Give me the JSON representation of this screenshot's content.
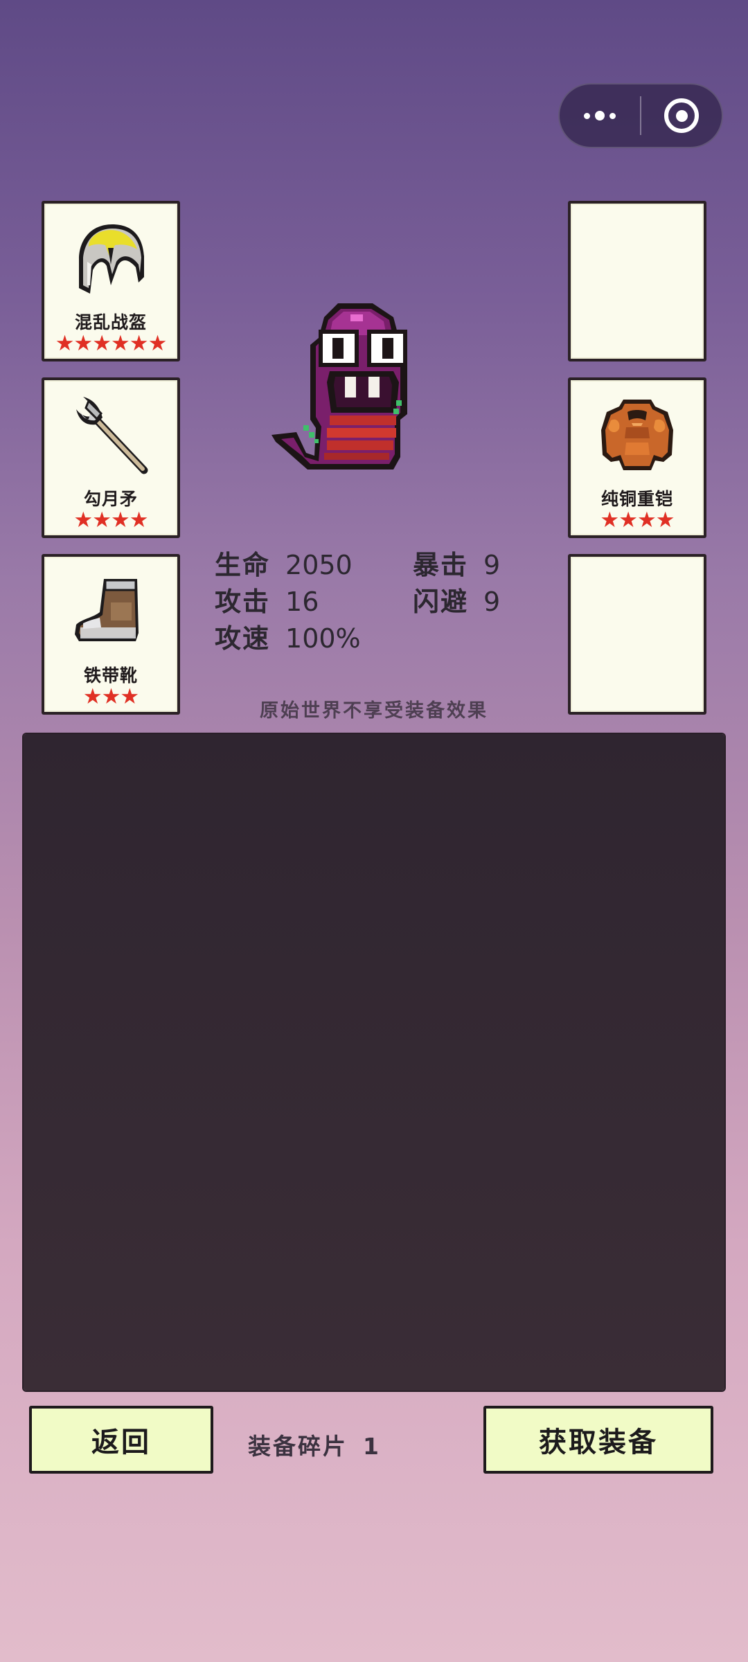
{
  "capsule": {
    "menu_icon": "more-dots-icon",
    "close_icon": "target-circle-icon"
  },
  "slots": {
    "helmet": {
      "name": "混乱战盔",
      "stars": "★★★★★★",
      "icon": "helmet-icon"
    },
    "weapon": {
      "name": "勾月矛",
      "stars": "★★★★",
      "icon": "spear-icon"
    },
    "boots": {
      "name": "铁带靴",
      "stars": "★★★",
      "icon": "boot-icon"
    },
    "armor": {
      "name": "纯铜重铠",
      "stars": "★★★★",
      "icon": "armor-icon"
    },
    "empty_top": {
      "name": ""
    },
    "empty_bottom": {
      "name": ""
    }
  },
  "monster": {
    "icon": "purple-worm-monster"
  },
  "stats": {
    "hp_label": "生命",
    "hp_value": "2050",
    "atk_label": "攻击",
    "atk_value": "16",
    "spd_label": "攻速",
    "spd_value": "100%",
    "crit_label": "暴击",
    "crit_value": "9",
    "dodge_label": "闪避",
    "dodge_value": "9"
  },
  "notice": "原始世界不享受装备效果",
  "footer": {
    "back_label": "返回",
    "fragments_label": "装备碎片",
    "fragments_value": "1",
    "get_label": "获取装备"
  },
  "colors": {
    "star": "#e03024",
    "button_bg": "#f1fbc6",
    "panel_bg": "#33282f",
    "slot_bg": "#fbfbed"
  }
}
